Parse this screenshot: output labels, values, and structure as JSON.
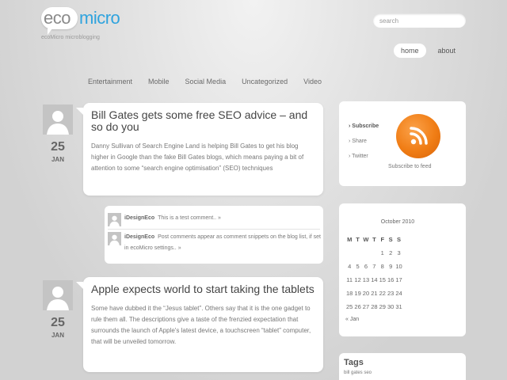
{
  "header": {
    "logo_eco": "eco",
    "logo_micro": "micro",
    "tagline": "ecoMicro microblogging",
    "search_placeholder": "search"
  },
  "nav": {
    "home": "home",
    "about": "about"
  },
  "categories": [
    "Entertainment",
    "Mobile",
    "Social Media",
    "Uncategorized",
    "Video"
  ],
  "posts": [
    {
      "title": "Bill Gates gets some free SEO advice – and so do you",
      "day": "25",
      "month": "JAN",
      "body": "Danny Sullivan of Search Engine Land is helping Bill Gates to get his blog higher in Google than the fake Bill Gates blogs, which means paying a bit of attention to some “search engine optimisation” (SEO) techniques"
    },
    {
      "title": "Apple expects world to start taking the tablets",
      "day": "25",
      "month": "JAN",
      "body": "Some have dubbed it the “Jesus tablet”. Others say that it is the one gadget to rule them all. The descriptions give a taste of the frenzied expectation that surrounds the launch of Apple's latest device, a touchscreen “tablet” computer, that will be unveiled tomorrow."
    }
  ],
  "comments": [
    {
      "author": "iDesignEco",
      "text": "This is a test comment.. »"
    },
    {
      "author": "iDesignEco",
      "text": "Post comments appear as comment snippets on the blog list, if set in ecoMicro settings.. »"
    }
  ],
  "subscribe": {
    "links": [
      "› Subscribe",
      "› Share",
      "› Twitter"
    ],
    "feed_label": "Subscribe to feed"
  },
  "calendar": {
    "title": "October 2010",
    "headers": [
      "M",
      "T",
      "W",
      "T",
      "F",
      "S",
      "S"
    ],
    "weeks": [
      [
        "",
        "",
        "",
        "",
        "1",
        "2",
        "3"
      ],
      [
        "4",
        "5",
        "6",
        "7",
        "8",
        "9",
        "10"
      ],
      [
        "11",
        "12",
        "13",
        "14",
        "15",
        "16",
        "17"
      ],
      [
        "18",
        "19",
        "20",
        "21",
        "22",
        "23",
        "24"
      ],
      [
        "25",
        "26",
        "27",
        "28",
        "29",
        "30",
        "31"
      ]
    ],
    "prev": "« Jan"
  },
  "tags": {
    "title": "Tags",
    "list": "bill gates seo"
  },
  "colors": {
    "accent_blue": "#2fa3de",
    "rss_orange": "#f07d15"
  }
}
